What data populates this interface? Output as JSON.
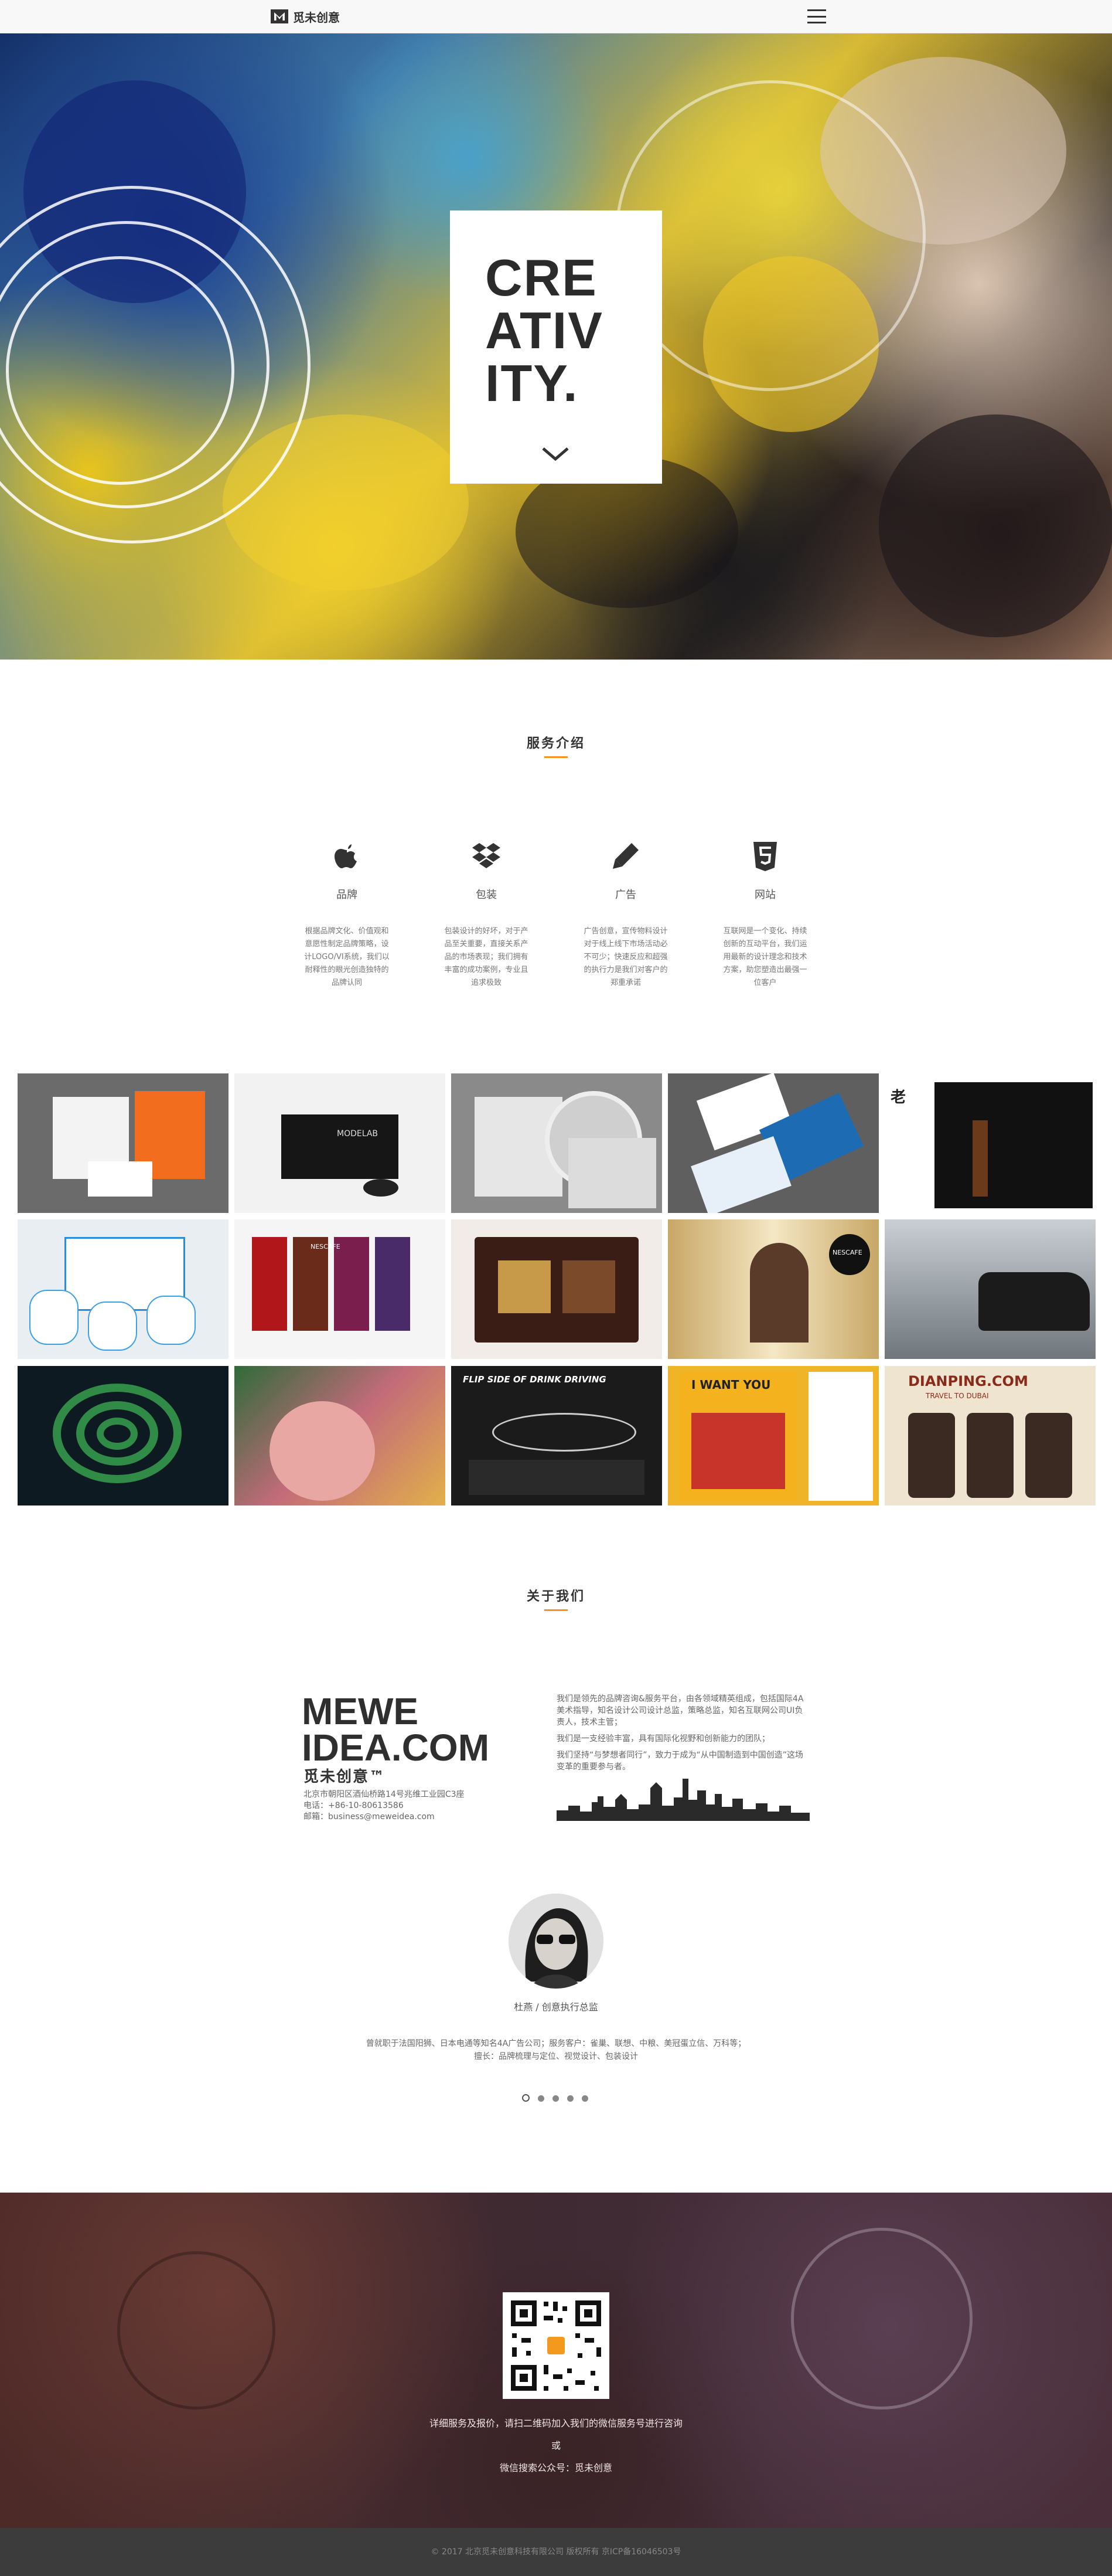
{
  "nav": {
    "logo_text": "觅未创意"
  },
  "hero": {
    "title": "CRE\nATIV\nITY."
  },
  "services": {
    "title": "服务介绍",
    "items": [
      {
        "icon": "apple-icon",
        "name": "品牌",
        "desc": "根据品牌文化、价值观和意愿性制定品牌策略，设计LOGO/VI系统，我们以耐释性的眼光创造独特的品牌认同"
      },
      {
        "icon": "dropbox-icon",
        "name": "包装",
        "desc": "包装设计的好坏，对于产品至关重要，直接关系产品的市场表现；我们拥有丰富的成功案例，专业且追求极致"
      },
      {
        "icon": "pencil-icon",
        "name": "广告",
        "desc": "广告创意，宣传物料设计对于线上线下市场活动必不可少；快速反应和超强的执行力是我们对客户的郑重承诺"
      },
      {
        "icon": "html5-icon",
        "name": "网站",
        "desc": "互联网是一个变化、持续创新的互动平台，我们运用最新的设计理念和技术方案，助您塑造出最强一位客户"
      }
    ]
  },
  "portfolio": {
    "tiles": [
      {
        "name": "orange-stationery",
        "bg": "#6b6b6b"
      },
      {
        "name": "black-modelab-box",
        "bg": "#f2f2f2"
      },
      {
        "name": "cd-packaging",
        "bg": "#8a8a8a"
      },
      {
        "name": "blue-cards",
        "bg": "#5f5f5f"
      },
      {
        "name": "black-wine-box",
        "bg": "#ffffff"
      },
      {
        "name": "tea-cans",
        "bg": "#e9eef2"
      },
      {
        "name": "nescafe-packs",
        "bg": "#f5f5f5"
      },
      {
        "name": "gift-box",
        "bg": "#f1ece8"
      },
      {
        "name": "nescafe-ad",
        "bg": "#d9c49a"
      },
      {
        "name": "car-storm",
        "bg": "#9aa0a6"
      },
      {
        "name": "green-coil-ad",
        "bg": "#0e1a22"
      },
      {
        "name": "illustration-poster",
        "bg": "#7a5a6a"
      },
      {
        "name": "drink-driving-poster",
        "bg": "#1b1b1b"
      },
      {
        "name": "yellow-magazine",
        "bg": "#f0b429"
      },
      {
        "name": "dianping-app",
        "bg": "#efe4cf"
      }
    ],
    "labels": {
      "modelab": "MODELAB",
      "nescafe": "NESCAFE",
      "drink": "FLIP SIDE OF DRINK DRIVING",
      "dianping": "DIANPING.COM",
      "dianping_sub": "TRAVEL TO DUBAI",
      "iwant": "I WANT YOU"
    }
  },
  "about": {
    "title": "关于我们",
    "brand_big": "MEWE\nIDEA.COM",
    "brand_cn": "觅未创意™",
    "address": "北京市朝阳区酒仙桥路14号兆维工业园C3座",
    "phone": "电话：+86-10-80613586",
    "email": "邮箱：business@meweidea.com",
    "para1": "我们是领先的品牌咨询&服务平台，由各领域精英组成，包括国际4A美术指导，知名设计公司设计总监，策略总监，知名互联网公司UI负责人，技术主管；",
    "para2": "我们是一支经验丰富，具有国际化视野和创新能力的团队；",
    "para3": "我们坚持“与梦想者同行”，致力于成为“从中国制造到中国创造”这场变革的重要参与者。",
    "person_name": "杜燕 / 创意执行总监",
    "person_bio": "曾就职于法国阳狮、日本电通等知名4A广告公司；服务客户：雀巢、联想、中粮、美冠蛋立信、万科等；擅长：品牌梳理与定位、视觉设计、包装设计",
    "slide_count": 5,
    "slide_active": 1
  },
  "contact": {
    "line1": "详细服务及报价，请扫二维码加入我们的微信服务号进行咨询",
    "line2": "或",
    "line3": "微信搜索公众号：觅未创意"
  },
  "footer": {
    "copyright": "© 2017 北京觅未创意科技有限公司 版权所有 京ICP备16046503号"
  }
}
